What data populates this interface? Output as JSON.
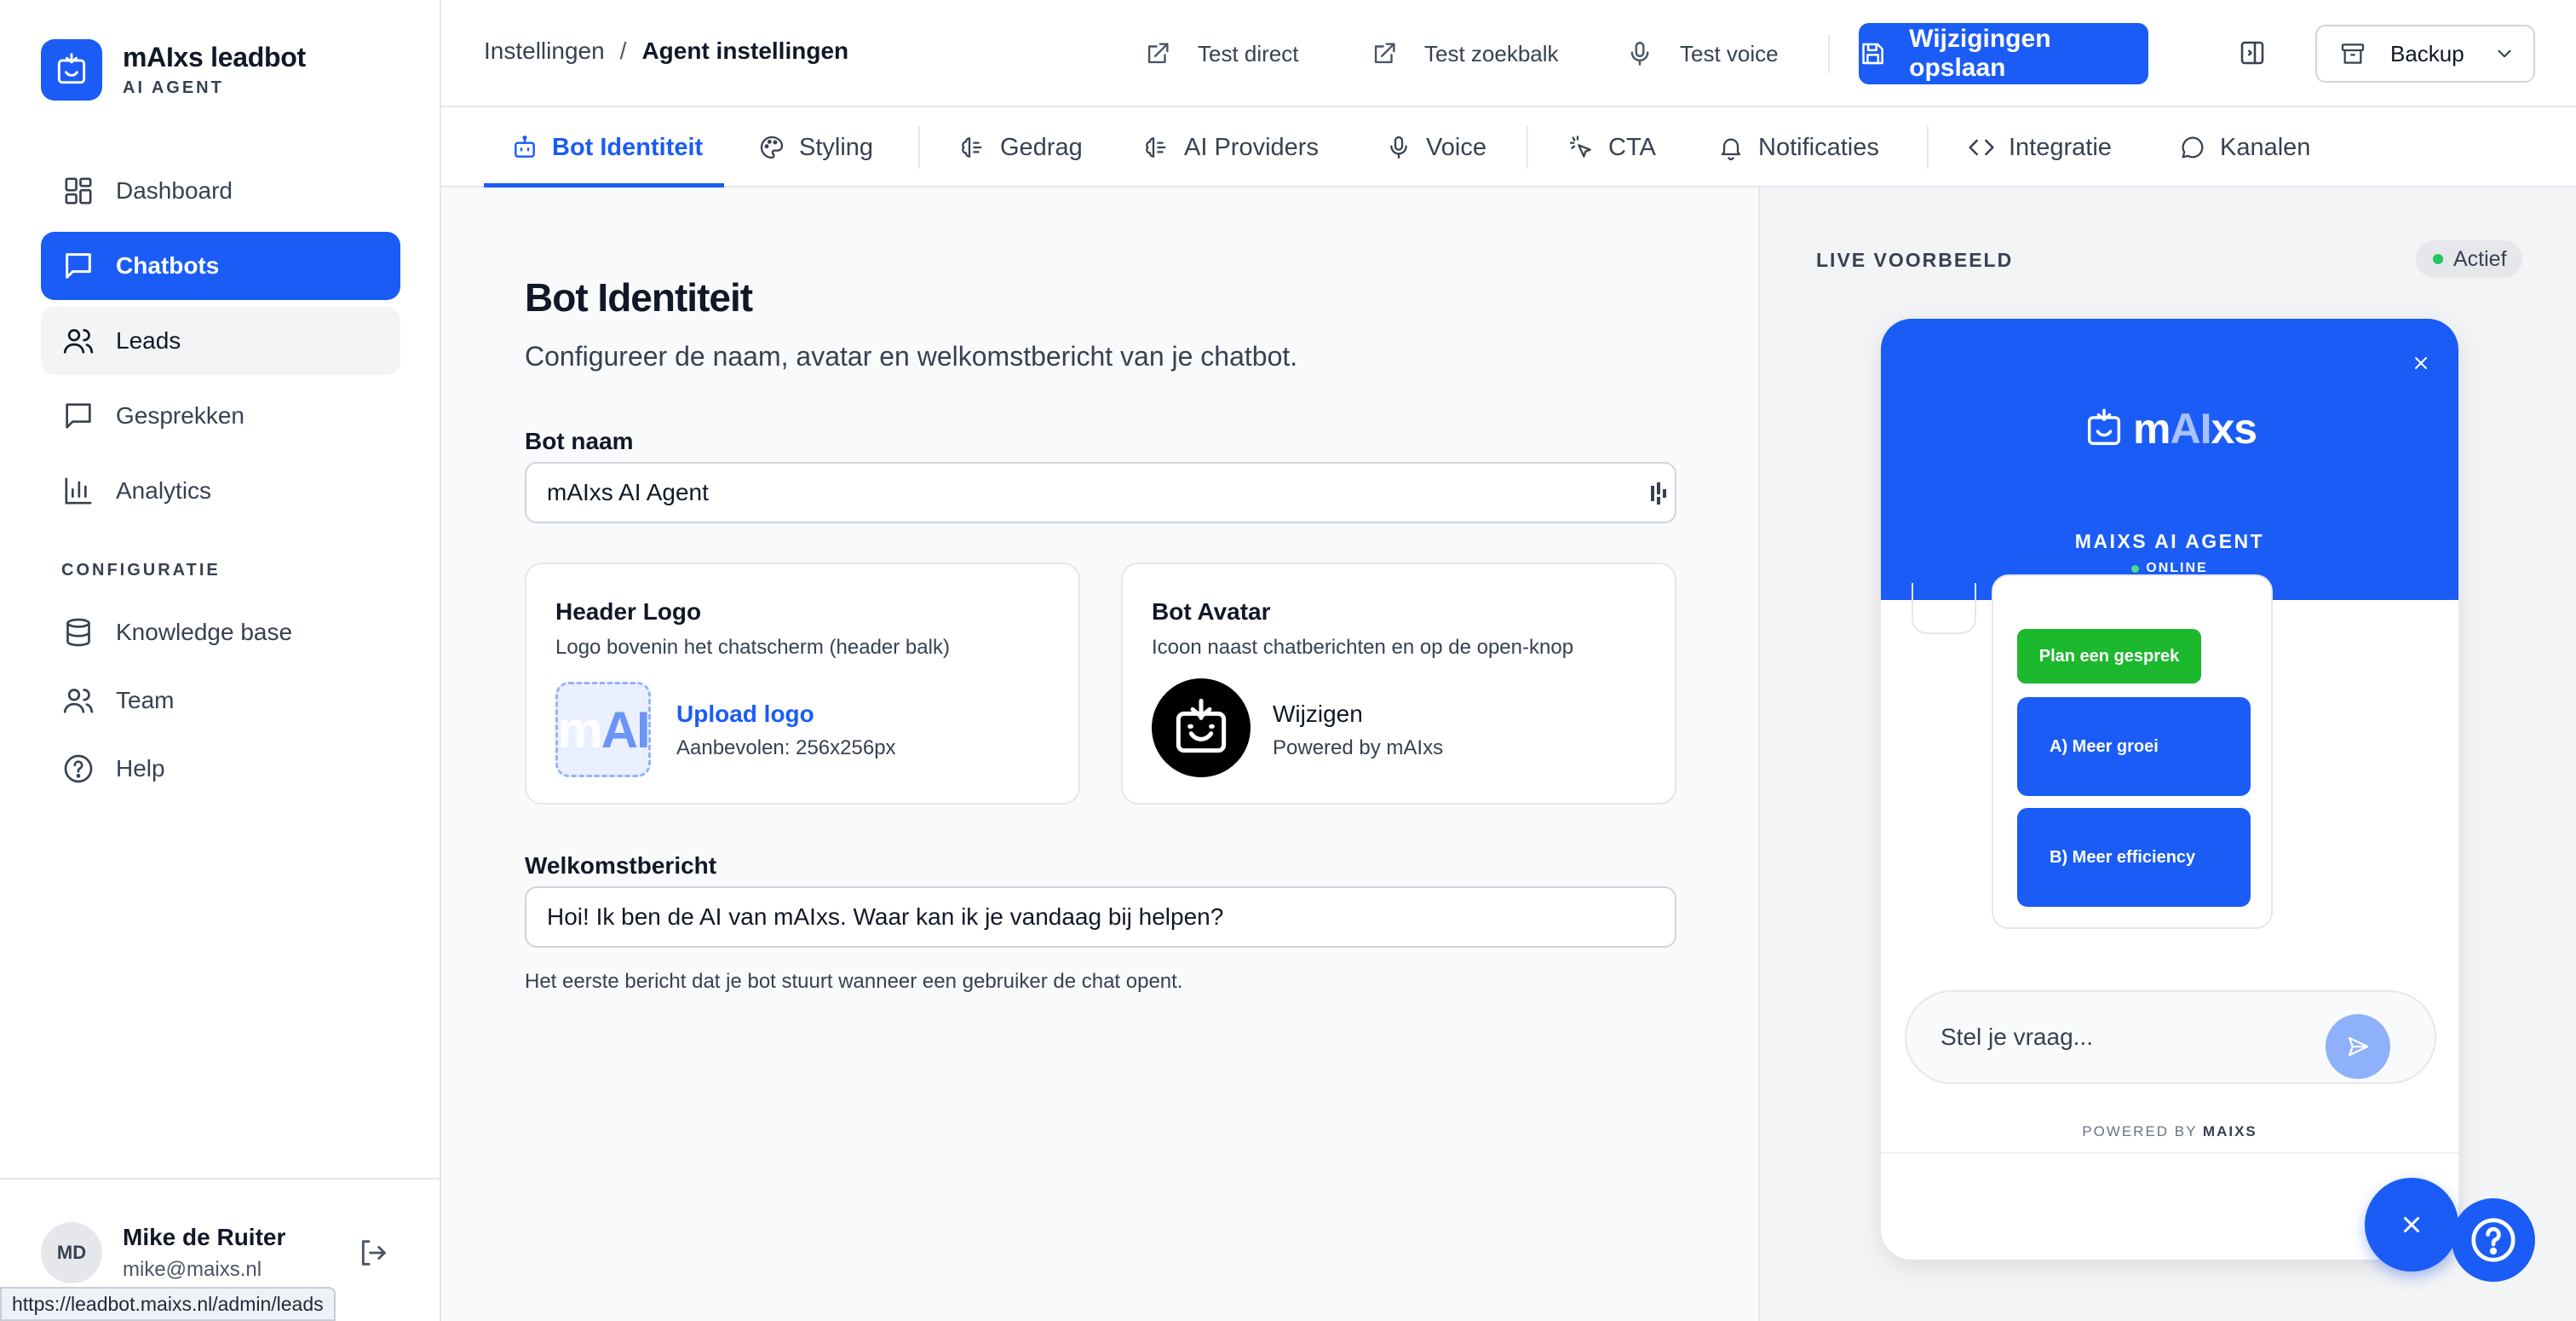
{
  "brand": {
    "name": "mAIxs leadbot",
    "subtitle": "AI AGENT"
  },
  "sidebar": {
    "items": [
      {
        "label": "Dashboard",
        "icon": "grid-icon"
      },
      {
        "label": "Chatbots",
        "icon": "chat-icon",
        "active": true
      },
      {
        "label": "Leads",
        "icon": "users-icon",
        "hover": true
      },
      {
        "label": "Gesprekken",
        "icon": "message-icon"
      },
      {
        "label": "Analytics",
        "icon": "bar-chart-icon"
      }
    ],
    "section_label": "CONFIGURATIE",
    "config_items": [
      {
        "label": "Knowledge base",
        "icon": "database-icon"
      },
      {
        "label": "Team",
        "icon": "users-icon"
      },
      {
        "label": "Help",
        "icon": "help-circle-icon"
      }
    ]
  },
  "user": {
    "initials": "MD",
    "name": "Mike de Ruiter",
    "email": "mike@maixs.nl"
  },
  "status_url": "https://leadbot.maixs.nl/admin/leads",
  "breadcrumb": {
    "parent": "Instellingen",
    "separator": "/",
    "current": "Agent instellingen"
  },
  "toolbar": {
    "test_direct": "Test direct",
    "test_search": "Test zoekbalk",
    "test_voice": "Test voice",
    "save": "Wijzigingen opslaan",
    "backup": "Backup"
  },
  "tabs": [
    {
      "label": "Bot Identiteit",
      "active": true
    },
    {
      "label": "Styling"
    },
    {
      "label": "Gedrag"
    },
    {
      "label": "AI Providers"
    },
    {
      "label": "Voice"
    },
    {
      "label": "CTA"
    },
    {
      "label": "Notificaties"
    },
    {
      "label": "Integratie"
    },
    {
      "label": "Kanalen"
    }
  ],
  "form": {
    "title": "Bot Identiteit",
    "description": "Configureer de naam, avatar en welkomstbericht van je chatbot.",
    "bot_name_label": "Bot naam",
    "bot_name_value": "mAIxs AI Agent",
    "header_logo": {
      "title": "Header Logo",
      "description": "Logo bovenin het chatscherm (header balk)",
      "logo_text_a": "m",
      "logo_text_b": "AI",
      "link": "Upload logo",
      "hint": "Aanbevolen: 256x256px"
    },
    "bot_avatar": {
      "title": "Bot Avatar",
      "description": "Icoon naast chatberichten en op de open-knop",
      "action": "Wijzigen",
      "sub": "Powered by mAIxs"
    },
    "welcome_label": "Welkomstbericht",
    "welcome_value": "Hoi! Ik ben de AI van mAIxs. Waar kan ik je vandaag bij helpen?",
    "welcome_hint": "Het eerste bericht dat je bot stuurt wanneer een gebruiker de chat opent."
  },
  "preview": {
    "label": "LIVE VOORBEELD",
    "status": "Actief",
    "widget": {
      "logo_a": "m",
      "logo_b": "AI",
      "logo_c": "xs",
      "name": "MAIXS AI AGENT",
      "online": "ONLINE",
      "plan_button": "Plan een gesprek",
      "option_a": "A) Meer groei",
      "option_b": "B) Meer efficiency",
      "input_placeholder": "Stel je vraag...",
      "powered_prefix": "POWERED BY",
      "powered_brand": "MAIXS"
    }
  },
  "colors": {
    "accent": "#1a5cf5",
    "success": "#1cb82e",
    "online": "#22c55e"
  }
}
